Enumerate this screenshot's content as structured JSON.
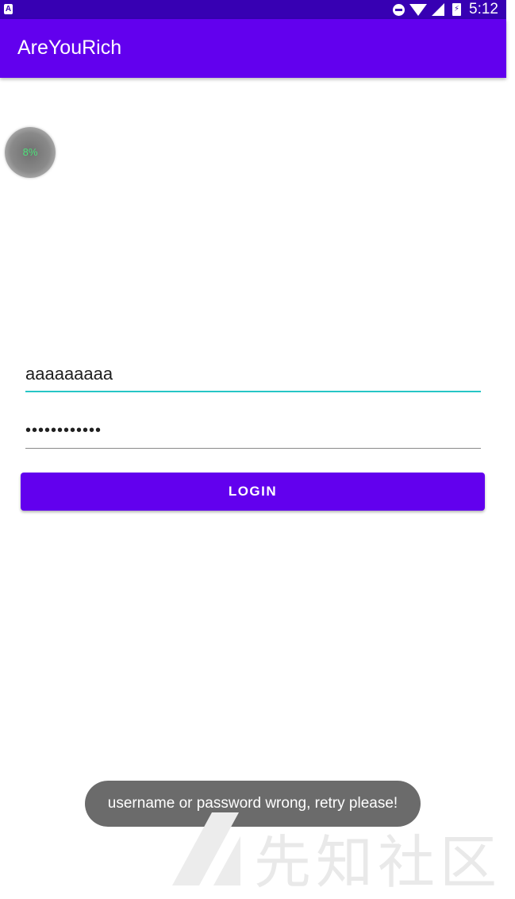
{
  "status_bar": {
    "notification_icon_label": "A",
    "time": "5:12",
    "icons": [
      "notification-icon",
      "dnd-icon",
      "wifi-icon",
      "signal-icon",
      "battery-charging-icon"
    ]
  },
  "app_bar": {
    "title": "AreYouRich",
    "color": "#6200ee"
  },
  "progress_widget": {
    "text": "8%"
  },
  "form": {
    "username_value": "aaaaaaaaa",
    "password_value": "••••••••••••",
    "login_label": "LOGIN"
  },
  "toast": {
    "message": "username or password wrong, retry please!"
  },
  "watermark": {
    "text": "先知社区"
  },
  "colors": {
    "status_bar": "#3700b3",
    "primary": "#6200ee",
    "username_underline": "#26c6c6"
  }
}
